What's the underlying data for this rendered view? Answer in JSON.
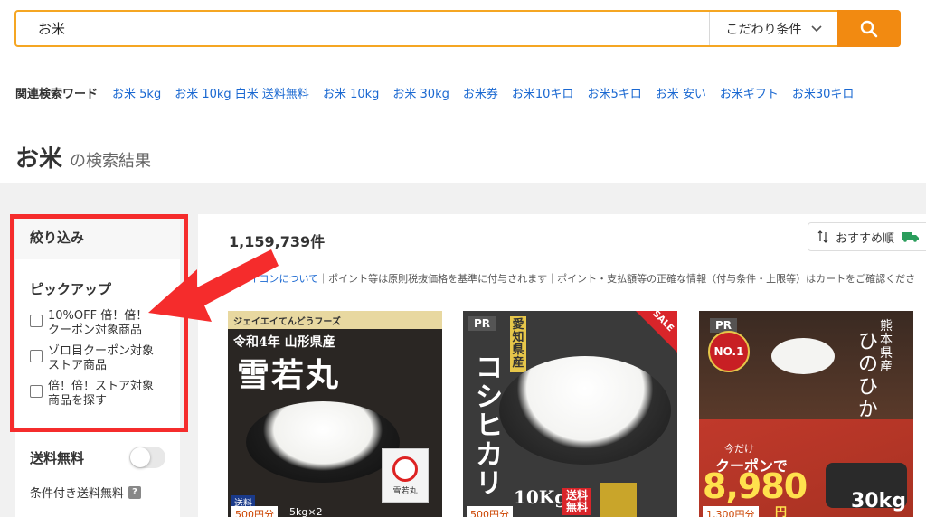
{
  "search": {
    "query": "お米",
    "filter_label": "こだわり条件",
    "icons": {
      "filter": "chevron-down-icon",
      "submit": "search-icon"
    }
  },
  "related": {
    "label": "関連検索ワード",
    "items": [
      "お米 5kg",
      "お米 10kg 白米 送料無料",
      "お米 10kg",
      "お米 30kg",
      "お米券",
      "お米10キロ",
      "お米5キロ",
      "お米 安い",
      "お米ギフト",
      "お米30キロ"
    ]
  },
  "title": {
    "query": "お米",
    "suffix": "の検索結果"
  },
  "sidebar": {
    "header": "絞り込み",
    "pickup_title": "ピックアップ",
    "options": [
      {
        "line1": "10%OFF 倍！倍！",
        "line2": "クーポン対象商品",
        "checked": false
      },
      {
        "line1": "ゾロ目クーポン対象",
        "line2": "ストア商品",
        "checked": false
      },
      {
        "line1": "倍！倍！ストア対象",
        "line2": "商品を探す",
        "checked": false
      }
    ],
    "free_shipping": {
      "label": "送料無料",
      "on": false
    },
    "conditional_shipping": "条件付き送料無料",
    "help_glyph": "?"
  },
  "results": {
    "count": "1,159,739件",
    "sort_label": "おすすめ順",
    "notice_link": "アイコンについて",
    "notice_text": "｜ポイント等は原則税抜価格を基準に付与されます｜ポイント・支払額等の正確な情報（付与条件・上限等）はカートをご確認くださ",
    "cards": [
      {
        "maker": "ジェイエイてんどうフーズ",
        "subtitle": "令和4年 山形県産",
        "name": "雪若丸",
        "weight": "5kg×2",
        "badge_text": "送料",
        "points": "500円分",
        "package_label": "雪若丸"
      },
      {
        "pr": "PR",
        "origin": "愛知県産",
        "name": "コシヒカリ",
        "weight": "10Kg",
        "shipping": "送料無料",
        "sale": "SALE",
        "points": "500円分"
      },
      {
        "pr": "PR",
        "rank": "NO.1",
        "origin": "熊本県産",
        "name": "ひのひかり",
        "coupon_top": "今だけ",
        "coupon": "クーポンで",
        "price": "8,980",
        "yen": "円",
        "weight": "30kg",
        "points": "1,300円分"
      }
    ]
  },
  "colors": {
    "accent": "#f28a11",
    "search_border": "#f5a623",
    "link": "#1a68d1",
    "highlight": "#f52c2c",
    "background_gray": "#f1f1f1"
  }
}
